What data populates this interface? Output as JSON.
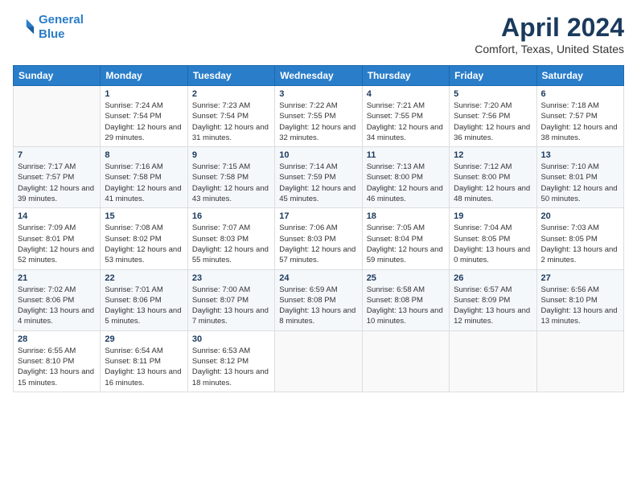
{
  "header": {
    "logo_line1": "General",
    "logo_line2": "Blue",
    "month": "April 2024",
    "location": "Comfort, Texas, United States"
  },
  "days_of_week": [
    "Sunday",
    "Monday",
    "Tuesday",
    "Wednesday",
    "Thursday",
    "Friday",
    "Saturday"
  ],
  "weeks": [
    [
      {
        "num": "",
        "empty": true
      },
      {
        "num": "1",
        "sunrise": "Sunrise: 7:24 AM",
        "sunset": "Sunset: 7:54 PM",
        "daylight": "Daylight: 12 hours and 29 minutes."
      },
      {
        "num": "2",
        "sunrise": "Sunrise: 7:23 AM",
        "sunset": "Sunset: 7:54 PM",
        "daylight": "Daylight: 12 hours and 31 minutes."
      },
      {
        "num": "3",
        "sunrise": "Sunrise: 7:22 AM",
        "sunset": "Sunset: 7:55 PM",
        "daylight": "Daylight: 12 hours and 32 minutes."
      },
      {
        "num": "4",
        "sunrise": "Sunrise: 7:21 AM",
        "sunset": "Sunset: 7:55 PM",
        "daylight": "Daylight: 12 hours and 34 minutes."
      },
      {
        "num": "5",
        "sunrise": "Sunrise: 7:20 AM",
        "sunset": "Sunset: 7:56 PM",
        "daylight": "Daylight: 12 hours and 36 minutes."
      },
      {
        "num": "6",
        "sunrise": "Sunrise: 7:18 AM",
        "sunset": "Sunset: 7:57 PM",
        "daylight": "Daylight: 12 hours and 38 minutes."
      }
    ],
    [
      {
        "num": "7",
        "sunrise": "Sunrise: 7:17 AM",
        "sunset": "Sunset: 7:57 PM",
        "daylight": "Daylight: 12 hours and 39 minutes."
      },
      {
        "num": "8",
        "sunrise": "Sunrise: 7:16 AM",
        "sunset": "Sunset: 7:58 PM",
        "daylight": "Daylight: 12 hours and 41 minutes."
      },
      {
        "num": "9",
        "sunrise": "Sunrise: 7:15 AM",
        "sunset": "Sunset: 7:58 PM",
        "daylight": "Daylight: 12 hours and 43 minutes."
      },
      {
        "num": "10",
        "sunrise": "Sunrise: 7:14 AM",
        "sunset": "Sunset: 7:59 PM",
        "daylight": "Daylight: 12 hours and 45 minutes."
      },
      {
        "num": "11",
        "sunrise": "Sunrise: 7:13 AM",
        "sunset": "Sunset: 8:00 PM",
        "daylight": "Daylight: 12 hours and 46 minutes."
      },
      {
        "num": "12",
        "sunrise": "Sunrise: 7:12 AM",
        "sunset": "Sunset: 8:00 PM",
        "daylight": "Daylight: 12 hours and 48 minutes."
      },
      {
        "num": "13",
        "sunrise": "Sunrise: 7:10 AM",
        "sunset": "Sunset: 8:01 PM",
        "daylight": "Daylight: 12 hours and 50 minutes."
      }
    ],
    [
      {
        "num": "14",
        "sunrise": "Sunrise: 7:09 AM",
        "sunset": "Sunset: 8:01 PM",
        "daylight": "Daylight: 12 hours and 52 minutes."
      },
      {
        "num": "15",
        "sunrise": "Sunrise: 7:08 AM",
        "sunset": "Sunset: 8:02 PM",
        "daylight": "Daylight: 12 hours and 53 minutes."
      },
      {
        "num": "16",
        "sunrise": "Sunrise: 7:07 AM",
        "sunset": "Sunset: 8:03 PM",
        "daylight": "Daylight: 12 hours and 55 minutes."
      },
      {
        "num": "17",
        "sunrise": "Sunrise: 7:06 AM",
        "sunset": "Sunset: 8:03 PM",
        "daylight": "Daylight: 12 hours and 57 minutes."
      },
      {
        "num": "18",
        "sunrise": "Sunrise: 7:05 AM",
        "sunset": "Sunset: 8:04 PM",
        "daylight": "Daylight: 12 hours and 59 minutes."
      },
      {
        "num": "19",
        "sunrise": "Sunrise: 7:04 AM",
        "sunset": "Sunset: 8:05 PM",
        "daylight": "Daylight: 13 hours and 0 minutes."
      },
      {
        "num": "20",
        "sunrise": "Sunrise: 7:03 AM",
        "sunset": "Sunset: 8:05 PM",
        "daylight": "Daylight: 13 hours and 2 minutes."
      }
    ],
    [
      {
        "num": "21",
        "sunrise": "Sunrise: 7:02 AM",
        "sunset": "Sunset: 8:06 PM",
        "daylight": "Daylight: 13 hours and 4 minutes."
      },
      {
        "num": "22",
        "sunrise": "Sunrise: 7:01 AM",
        "sunset": "Sunset: 8:06 PM",
        "daylight": "Daylight: 13 hours and 5 minutes."
      },
      {
        "num": "23",
        "sunrise": "Sunrise: 7:00 AM",
        "sunset": "Sunset: 8:07 PM",
        "daylight": "Daylight: 13 hours and 7 minutes."
      },
      {
        "num": "24",
        "sunrise": "Sunrise: 6:59 AM",
        "sunset": "Sunset: 8:08 PM",
        "daylight": "Daylight: 13 hours and 8 minutes."
      },
      {
        "num": "25",
        "sunrise": "Sunrise: 6:58 AM",
        "sunset": "Sunset: 8:08 PM",
        "daylight": "Daylight: 13 hours and 10 minutes."
      },
      {
        "num": "26",
        "sunrise": "Sunrise: 6:57 AM",
        "sunset": "Sunset: 8:09 PM",
        "daylight": "Daylight: 13 hours and 12 minutes."
      },
      {
        "num": "27",
        "sunrise": "Sunrise: 6:56 AM",
        "sunset": "Sunset: 8:10 PM",
        "daylight": "Daylight: 13 hours and 13 minutes."
      }
    ],
    [
      {
        "num": "28",
        "sunrise": "Sunrise: 6:55 AM",
        "sunset": "Sunset: 8:10 PM",
        "daylight": "Daylight: 13 hours and 15 minutes."
      },
      {
        "num": "29",
        "sunrise": "Sunrise: 6:54 AM",
        "sunset": "Sunset: 8:11 PM",
        "daylight": "Daylight: 13 hours and 16 minutes."
      },
      {
        "num": "30",
        "sunrise": "Sunrise: 6:53 AM",
        "sunset": "Sunset: 8:12 PM",
        "daylight": "Daylight: 13 hours and 18 minutes."
      },
      {
        "num": "",
        "empty": true
      },
      {
        "num": "",
        "empty": true
      },
      {
        "num": "",
        "empty": true
      },
      {
        "num": "",
        "empty": true
      }
    ]
  ]
}
